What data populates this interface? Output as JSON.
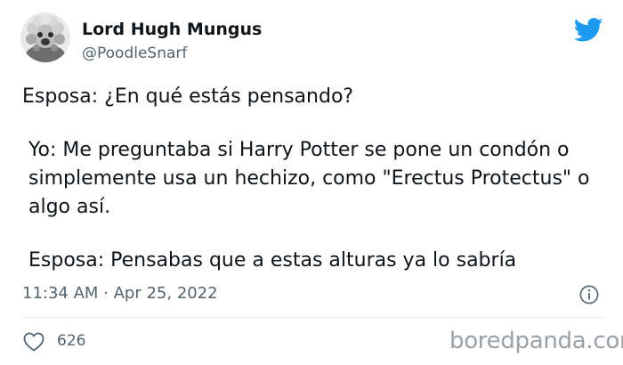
{
  "author": {
    "display_name": "Lord Hugh Mungus",
    "handle": "@PoodleSnarf"
  },
  "tweet": {
    "lines": [
      "Esposa: ¿En qué estás pensando?",
      "Yo: Me preguntaba si Harry Potter se pone un condón o simplemente usa un hechizo, como \"Erectus Protectus\" o algo así.",
      "Esposa: Pensabas que a estas alturas ya lo sabría"
    ]
  },
  "meta": {
    "timestamp": "11:34 AM · Apr 25, 2022",
    "like_count": "626"
  },
  "watermark": "boredpanda.com",
  "icons": {
    "brand": "twitter-bird-icon",
    "info": "info-icon",
    "like": "heart-icon"
  },
  "colors": {
    "twitter_blue": "#1d9bf0",
    "text": "#0f1419",
    "secondary_text": "#536471",
    "watermark": "#9aa0a6"
  }
}
